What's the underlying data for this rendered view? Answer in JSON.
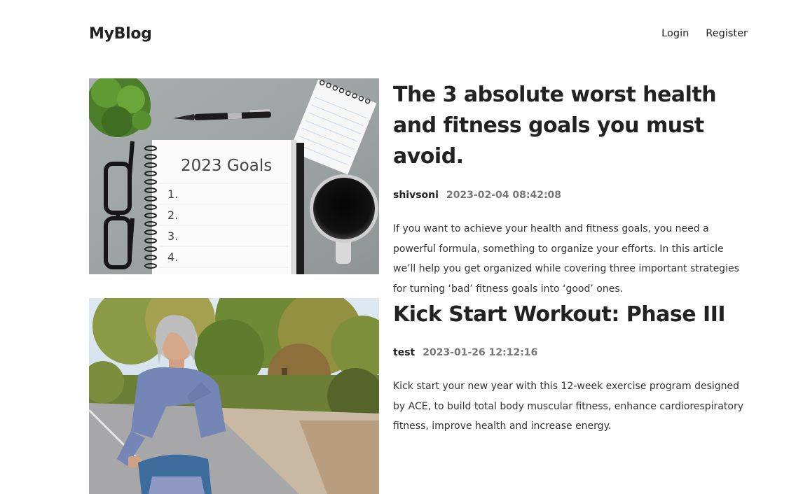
{
  "header": {
    "logo": "MyBlog",
    "nav": {
      "login": "Login",
      "register": "Register"
    }
  },
  "posts": [
    {
      "title": "The 3 absolute worst health and fitness goals you must avoid.",
      "author": "shivsoni",
      "date": "2023-02-04 08:42:08",
      "excerpt": "If you want to achieve your health and fitness goals, you need a powerful formula, something to organize your efforts. In this article we’ll help you get organized while covering three important strategies for turning ‘bad’ fitness goals into ‘good’ ones.",
      "image": {
        "notebook_heading": "2023 Goals",
        "list_numbers": [
          "1.",
          "2.",
          "3.",
          "4."
        ]
      }
    },
    {
      "title": "Kick Start Workout: Phase III",
      "author": "test",
      "date": "2023-01-26 12:12:16",
      "excerpt": "Kick start your new year with this 12-week exercise program designed by ACE, to build total body muscular fitness, enhance cardiorespiratory fitness, improve health and increase energy."
    }
  ]
}
